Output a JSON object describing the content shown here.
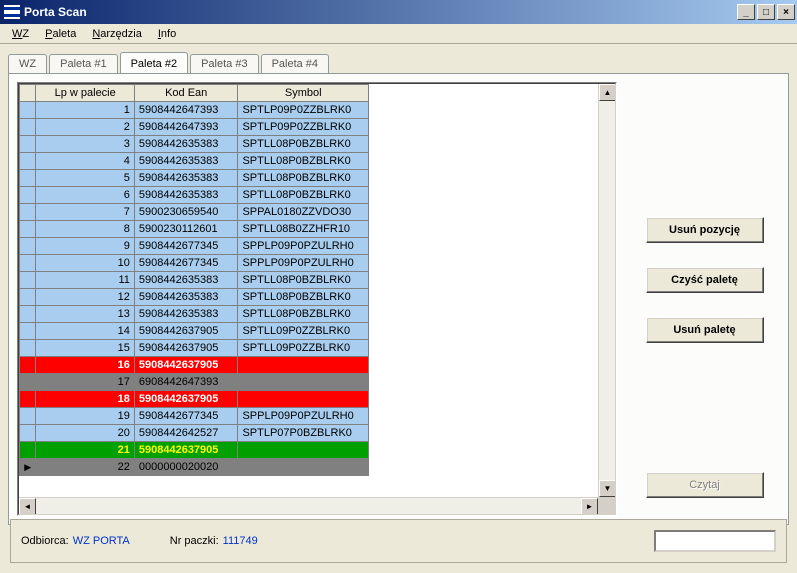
{
  "window": {
    "title": "Porta Scan"
  },
  "menu": {
    "wz": "WZ",
    "paleta": "Paleta",
    "narzedzia": "Narzędzia",
    "info": "Info"
  },
  "tabs": [
    {
      "label": "WZ"
    },
    {
      "label": "Paleta #1"
    },
    {
      "label": "Paleta #2",
      "active": true
    },
    {
      "label": "Paleta #3"
    },
    {
      "label": "Paleta #4"
    }
  ],
  "grid": {
    "headers": {
      "lp": "Lp w palecie",
      "ean": "Kod Ean",
      "sym": "Symbol"
    },
    "rows": [
      {
        "lp": "1",
        "ean": "5908442647393",
        "sym": "SPTLP09P0ZZBLRK0",
        "state": "blue"
      },
      {
        "lp": "2",
        "ean": "5908442647393",
        "sym": "SPTLP09P0ZZBLRK0",
        "state": "blue"
      },
      {
        "lp": "3",
        "ean": "5908442635383",
        "sym": "SPTLL08P0BZBLRK0",
        "state": "blue"
      },
      {
        "lp": "4",
        "ean": "5908442635383",
        "sym": "SPTLL08P0BZBLRK0",
        "state": "blue"
      },
      {
        "lp": "5",
        "ean": "5908442635383",
        "sym": "SPTLL08P0BZBLRK0",
        "state": "blue"
      },
      {
        "lp": "6",
        "ean": "5908442635383",
        "sym": "SPTLL08P0BZBLRK0",
        "state": "blue"
      },
      {
        "lp": "7",
        "ean": "5900230659540",
        "sym": "SPPAL0180ZZVDO30",
        "state": "blue"
      },
      {
        "lp": "8",
        "ean": "5900230112601",
        "sym": "SPTLL08B0ZZHFR10",
        "state": "blue"
      },
      {
        "lp": "9",
        "ean": "5908442677345",
        "sym": "SPPLP09P0PZULRH0",
        "state": "blue"
      },
      {
        "lp": "10",
        "ean": "5908442677345",
        "sym": "SPPLP09P0PZULRH0",
        "state": "blue"
      },
      {
        "lp": "11",
        "ean": "5908442635383",
        "sym": "SPTLL08P0BZBLRK0",
        "state": "blue"
      },
      {
        "lp": "12",
        "ean": "5908442635383",
        "sym": "SPTLL08P0BZBLRK0",
        "state": "blue"
      },
      {
        "lp": "13",
        "ean": "5908442635383",
        "sym": "SPTLL08P0BZBLRK0",
        "state": "blue"
      },
      {
        "lp": "14",
        "ean": "5908442637905",
        "sym": "SPTLL09P0ZZBLRK0",
        "state": "blue"
      },
      {
        "lp": "15",
        "ean": "5908442637905",
        "sym": "SPTLL09P0ZZBLRK0",
        "state": "blue"
      },
      {
        "lp": "16",
        "ean": "5908442637905",
        "sym": "",
        "state": "red"
      },
      {
        "lp": "17",
        "ean": "6908442647393",
        "sym": "",
        "state": "gray"
      },
      {
        "lp": "18",
        "ean": "5908442637905",
        "sym": "",
        "state": "red"
      },
      {
        "lp": "19",
        "ean": "5908442677345",
        "sym": "SPPLP09P0PZULRH0",
        "state": "blue"
      },
      {
        "lp": "20",
        "ean": "5908442642527",
        "sym": "SPTLP07P0BZBLRK0",
        "state": "blue"
      },
      {
        "lp": "21",
        "ean": "5908442637905",
        "sym": "",
        "state": "green"
      },
      {
        "lp": "22",
        "ean": "0000000020020",
        "sym": "",
        "state": "gray2",
        "current": true
      }
    ]
  },
  "actions": {
    "usun_pozycje": "Usuń pozycję",
    "czysc_palete": "Czyść paletę",
    "usun_palete": "Usuń paletę",
    "czytaj": "Czytaj"
  },
  "footer": {
    "odbiorca_label": "Odbiorca:",
    "odbiorca_value": "WZ PORTA",
    "nr_paczki_label": "Nr paczki:",
    "nr_paczki_value": "111749"
  }
}
